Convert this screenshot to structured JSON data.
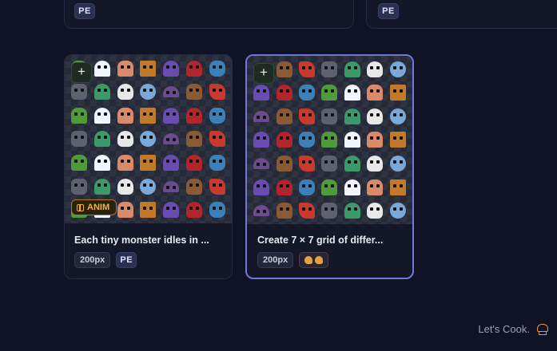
{
  "top_cards": [
    {
      "badge": "PE"
    },
    {
      "badge": "PE"
    }
  ],
  "cards": [
    {
      "title": "Each tiny monster idles in ...",
      "size": "200px",
      "badge": "PE",
      "anim_label": "ANIM",
      "add_icon": "+",
      "selected": false
    },
    {
      "title": "Create 7 × 7 grid of differ...",
      "size": "200px",
      "badge_icon": "two-hand-icons",
      "add_icon": "+",
      "selected": true
    }
  ],
  "footer": {
    "text": "Let's Cook.",
    "icon": "chef-hat-icon",
    "accent_color": "#e2953a"
  },
  "colors": {
    "background": "#0f1325",
    "card": "#131728",
    "selected_border": "#6f79d8",
    "anim_badge": "#f2b135"
  }
}
